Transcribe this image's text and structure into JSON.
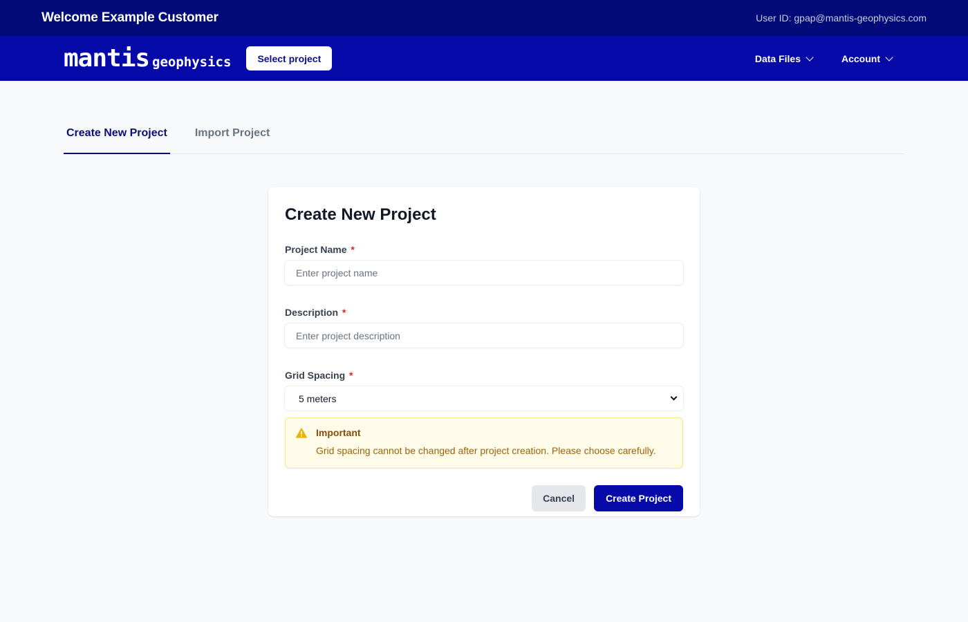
{
  "header": {
    "welcome": "Welcome Example Customer",
    "user_id": "User ID: gpap@mantis-geophysics.com"
  },
  "nav": {
    "logo_main": "mantis",
    "logo_sub": "geophysics",
    "select_project": "Select project",
    "data_files": "Data Files",
    "account": "Account"
  },
  "tabs": [
    {
      "label": "Create New Project",
      "active": true
    },
    {
      "label": "Import Project",
      "active": false
    }
  ],
  "form": {
    "title": "Create New Project",
    "project_name": {
      "label": "Project Name",
      "required": "*",
      "placeholder": "Enter project name",
      "value": ""
    },
    "description": {
      "label": "Description",
      "required": "*",
      "placeholder": "Enter project description",
      "value": ""
    },
    "grid_spacing": {
      "label": "Grid Spacing",
      "required": "*",
      "selected": "5 meters"
    },
    "alert": {
      "icon": "warning-triangle-icon",
      "title": "Important",
      "body": "Grid spacing cannot be changed after project creation. Please choose carefully."
    },
    "cancel_label": "Cancel",
    "submit_label": "Create Project"
  },
  "colors": {
    "topbar": "#000a78",
    "navbar": "#0509a8",
    "primary": "#0509a8",
    "warning": "#eab308"
  }
}
